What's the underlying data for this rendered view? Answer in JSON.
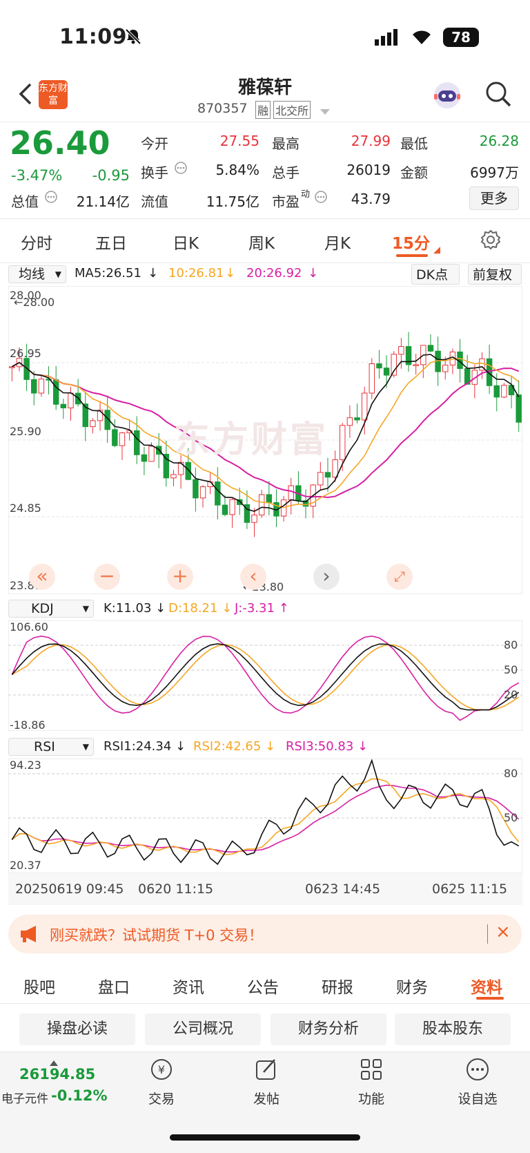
{
  "status": {
    "time": "11:09",
    "battery": "78"
  },
  "header": {
    "name": "雅葆轩",
    "code": "870357",
    "badge_rong": "融",
    "badge_exchange": "北交所",
    "logo_text": "东方财富"
  },
  "quote": {
    "price": "26.40",
    "pct": "-3.47%",
    "chg": "-0.95",
    "open_label": "今开",
    "open": "27.55",
    "high_label": "最高",
    "high": "27.99",
    "low_label": "最低",
    "low": "26.28",
    "turnover_label": "换手",
    "turnover": "5.84%",
    "vol_label": "总手",
    "vol": "26019",
    "amount_label": "金额",
    "amount": "6997万",
    "mcap_label": "总值",
    "mcap": "21.14亿",
    "float_label": "流值",
    "float": "11.75亿",
    "pe_label": "市盈",
    "pe_sup": "动",
    "pe": "43.79",
    "more": "更多"
  },
  "tabs": [
    "分时",
    "五日",
    "日K",
    "周K",
    "月K",
    "15分"
  ],
  "kline": {
    "indicator_select": "均线",
    "ma5": "MA5:26.51",
    "ma10": "10:26.81",
    "ma20": "20:26.92",
    "dk": "DK点",
    "adjust": "前复权",
    "y_labels": [
      "28.00",
      "26.95",
      "25.90",
      "24.85",
      "23.80"
    ],
    "high_marker": "28.00",
    "low_marker": "23.80",
    "watermark": "东方财富"
  },
  "kdj": {
    "select": "KDJ",
    "k": "K:11.03",
    "d": "D:18.21",
    "j": "J:-3.31",
    "top": "106.60",
    "bottom": "-18.86",
    "levels": [
      "80",
      "50",
      "20"
    ]
  },
  "rsi": {
    "select": "RSI",
    "r1": "RSI1:24.34",
    "r2": "RSI2:42.65",
    "r3": "RSI3:50.83",
    "top": "94.23",
    "bottom": "20.37",
    "levels": [
      "80",
      "50"
    ]
  },
  "time_axis": [
    "20250619 09:45",
    "0620 11:15",
    "0623 14:45",
    "0625 11:15"
  ],
  "banner": {
    "text": "刚买就跌？试试期货 T+0 交易！"
  },
  "sub_tabs": [
    "股吧",
    "盘口",
    "资讯",
    "公告",
    "研报",
    "财务",
    "资料"
  ],
  "seg_buttons": [
    "操盘必读",
    "公司概况",
    "财务分析",
    "股本股东"
  ],
  "bottom": {
    "index_value": "26194.85",
    "index_name": "电子元件",
    "index_pct": "-0.12%",
    "nav": [
      "交易",
      "发帖",
      "功能",
      "设自选"
    ]
  },
  "colors": {
    "red": "#e8333a",
    "green": "#1a9a3a",
    "orange": "#f5a623",
    "magenta": "#d61fa3",
    "accent": "#ee5a24"
  }
}
